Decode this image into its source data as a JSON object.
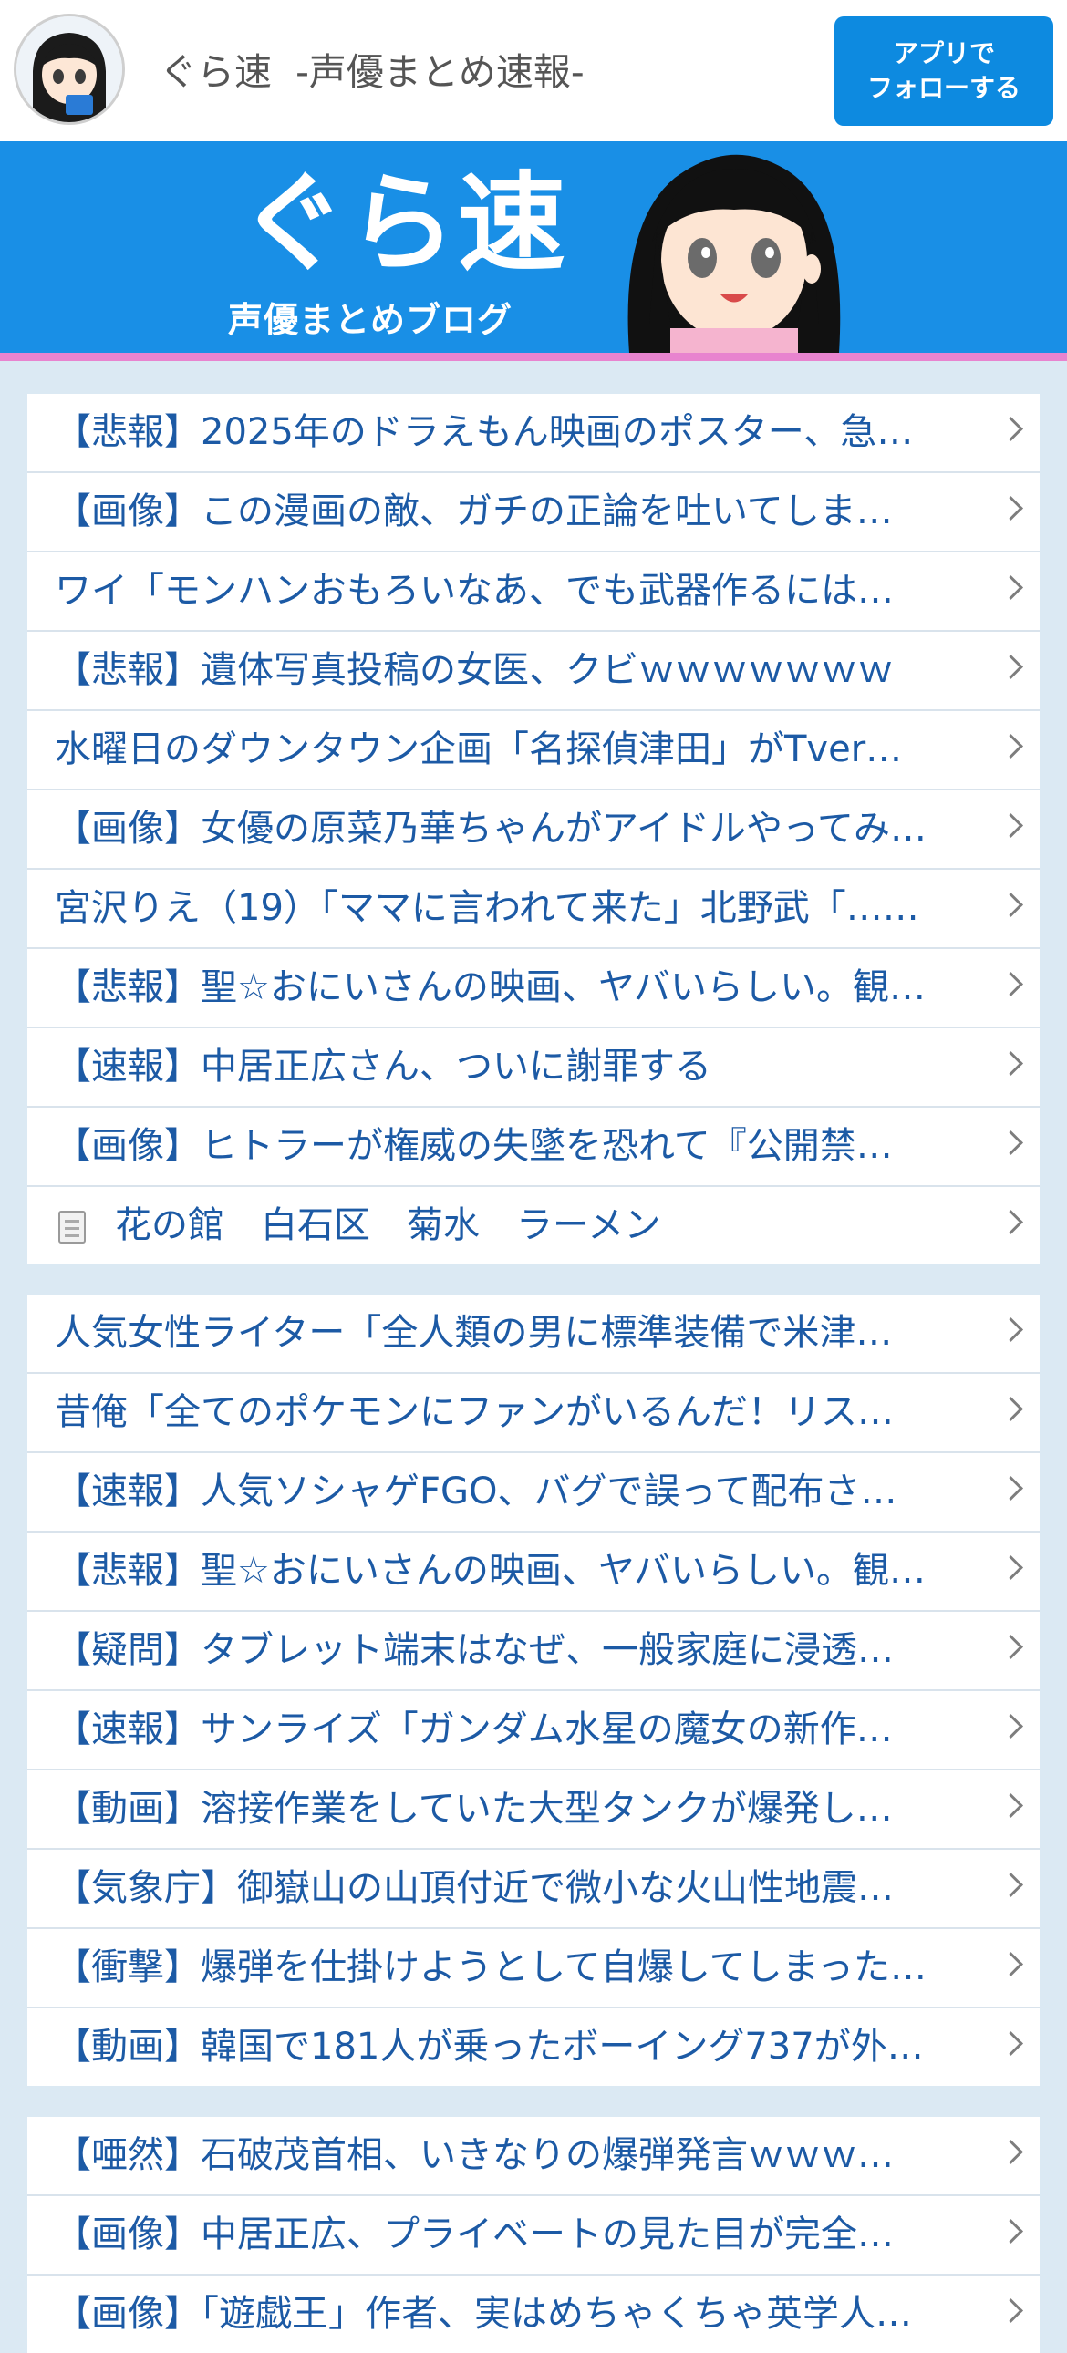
{
  "header": {
    "site_title": "ぐら速  -声優まとめ速報-",
    "follow_button_line1": "アプリで",
    "follow_button_line2": "フォローする"
  },
  "banner": {
    "logo_text": "ぐら速",
    "sub_text": "声優まとめブログ"
  },
  "groups": [
    {
      "items": [
        {
          "title": "【悲報】2025年のドラえもん映画のポスター、急…"
        },
        {
          "title": "【画像】この漫画の敵、ガチの正論を吐いてしま…"
        },
        {
          "title": "ワイ「モンハンおもろいなあ、でも武器作るには…"
        },
        {
          "title": "【悲報】遺体写真投稿の女医、クビｗｗｗｗｗｗｗ"
        },
        {
          "title": "水曜日のダウンタウン企画「名探偵津田」がTver…"
        },
        {
          "title": "【画像】女優の原菜乃華ちゃんがアイドルやってみ…"
        },
        {
          "title": "宮沢りえ（19）「ママに言われて来た」北野武「……"
        },
        {
          "title": "【悲報】聖☆おにいさんの映画、ヤバいらしい。観…"
        },
        {
          "title": "【速報】中居正広さん、ついに謝罪する"
        },
        {
          "title": "【画像】ヒトラーが権威の失墜を恐れて『公開禁…"
        },
        {
          "title": "花の館　白石区　菊水　ラーメン",
          "icon": "document-icon"
        }
      ]
    },
    {
      "items": [
        {
          "title": "人気女性ライター「全人類の男に標準装備で米津…"
        },
        {
          "title": "昔俺「全てのポケモンにファンがいるんだ！リス…"
        },
        {
          "title": "【速報】人気ソシャゲFGO、バグで誤って配布さ…"
        },
        {
          "title": "【悲報】聖☆おにいさんの映画、ヤバいらしい。観…"
        },
        {
          "title": "【疑問】タブレット端末はなぜ、一般家庭に浸透…"
        },
        {
          "title": "【速報】サンライズ「ガンダム水星の魔女の新作…"
        },
        {
          "title": "【動画】溶接作業をしていた大型タンクが爆発し…"
        },
        {
          "title": "【気象庁】御嶽山の山頂付近で微小な火山性地震…"
        },
        {
          "title": "【衝撃】爆弾を仕掛けようとして自爆してしまった…"
        },
        {
          "title": "【動画】韓国で181人が乗ったボーイング737が外…"
        }
      ]
    },
    {
      "items": [
        {
          "title": "【唖然】石破茂首相、いきなりの爆弾発言ｗｗｗ…"
        },
        {
          "title": "【画像】中居正広、プライベートの見た目が完全…"
        },
        {
          "title": "【画像】「遊戯王」作者、実はめちゃくちゃ英学人…"
        }
      ]
    }
  ]
}
